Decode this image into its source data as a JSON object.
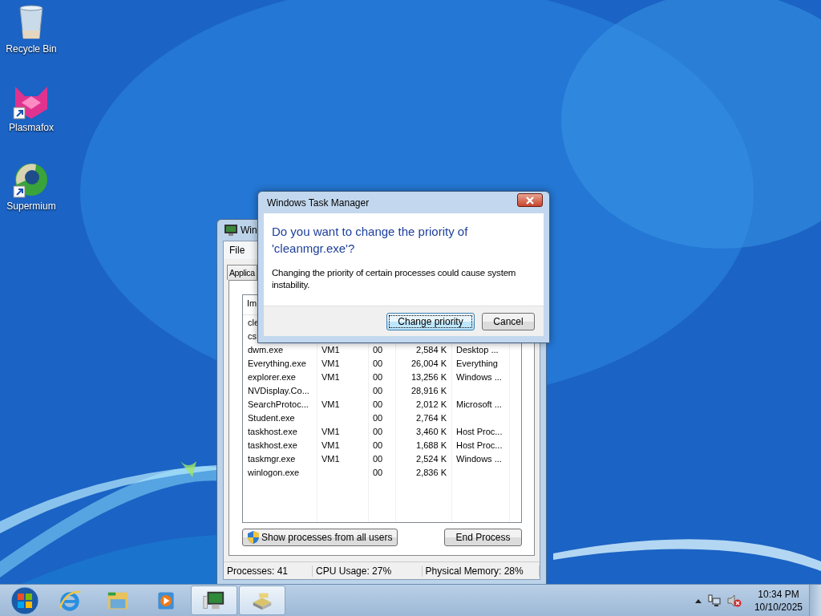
{
  "desktop_icons": [
    {
      "label": "Recycle Bin",
      "kind": "bin",
      "shortcut": false
    },
    {
      "label": "Plasmafox",
      "kind": "fox",
      "shortcut": true
    },
    {
      "label": "Supermium",
      "kind": "globe",
      "shortcut": true
    }
  ],
  "task_manager": {
    "title": "Win",
    "menu": [
      "File"
    ],
    "tabs": [
      {
        "label": "Applica",
        "selected": false
      }
    ],
    "columns": [
      "Im"
    ],
    "rows": [
      [
        "cle"
      ],
      [
        "cs"
      ],
      [
        "dwm.exe",
        "VM1",
        "00",
        "2,584 K",
        "Desktop ..."
      ],
      [
        "Everything.exe",
        "VM1",
        "00",
        "26,004 K",
        "Everything"
      ],
      [
        "explorer.exe",
        "VM1",
        "00",
        "13,256 K",
        "Windows ..."
      ],
      [
        "NVDisplay.Co...",
        "",
        "00",
        "28,916 K",
        ""
      ],
      [
        "SearchProtoc...",
        "VM1",
        "00",
        "2,012 K",
        "Microsoft ..."
      ],
      [
        "Student.exe",
        "",
        "00",
        "2,764 K",
        ""
      ],
      [
        "taskhost.exe",
        "VM1",
        "00",
        "3,460 K",
        "Host Proc..."
      ],
      [
        "taskhost.exe",
        "VM1",
        "00",
        "1,688 K",
        "Host Proc..."
      ],
      [
        "taskmgr.exe",
        "VM1",
        "00",
        "2,524 K",
        "Windows ..."
      ],
      [
        "winlogon.exe",
        "",
        "00",
        "2,836 K",
        ""
      ]
    ],
    "buttons": [
      {
        "label": "Show processes from all users",
        "shield": true
      },
      {
        "label": "End Process",
        "shield": false
      }
    ],
    "status_bar": [
      "Processes: 41",
      "CPU Usage: 27%",
      "Physical Memory: 28%"
    ]
  },
  "dialog": {
    "title": "Windows Task Manager",
    "heading": "Do you want to change the priority of 'cleanmgr.exe'?",
    "message": "Changing the priority of certain processes could cause system instability.",
    "buttons": [
      {
        "label": "Change priority",
        "focused": true
      },
      {
        "label": "Cancel",
        "focused": false
      }
    ]
  },
  "taskbar": {
    "items": [
      {
        "kind": "start",
        "running": false
      },
      {
        "kind": "ie",
        "running": false
      },
      {
        "kind": "folder",
        "running": false
      },
      {
        "kind": "media",
        "running": false
      },
      {
        "kind": "monitor",
        "running": true
      },
      {
        "kind": "drive",
        "running": true
      }
    ],
    "time": "10:34 PM",
    "date": "10/10/2025"
  }
}
